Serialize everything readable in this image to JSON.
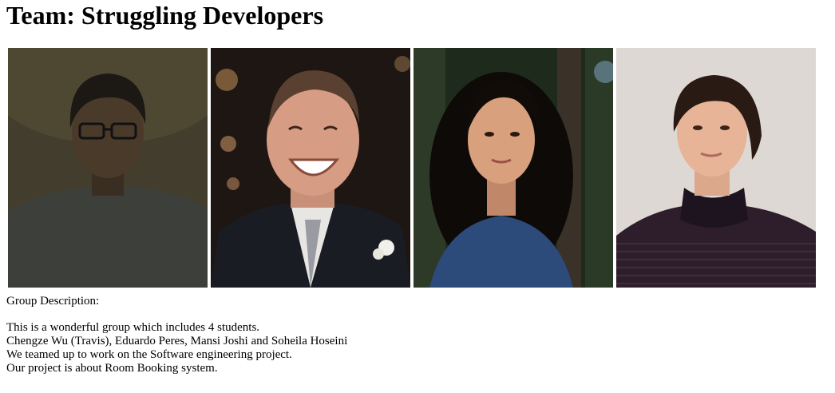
{
  "page": {
    "title": "Team: Struggling Developers"
  },
  "photos": [
    {
      "icon": "member-photo-1"
    },
    {
      "icon": "member-photo-2"
    },
    {
      "icon": "member-photo-3"
    },
    {
      "icon": "member-photo-4"
    }
  ],
  "description": {
    "label": "Group Description:",
    "lines": [
      "This is a wonderful group which includes 4 students.",
      "Chengze Wu (Travis), Eduardo Peres, Mansi Joshi and Soheila Hoseini",
      "We teamed up to work on the Software engineering project.",
      "Our project is about Room Booking system."
    ]
  }
}
